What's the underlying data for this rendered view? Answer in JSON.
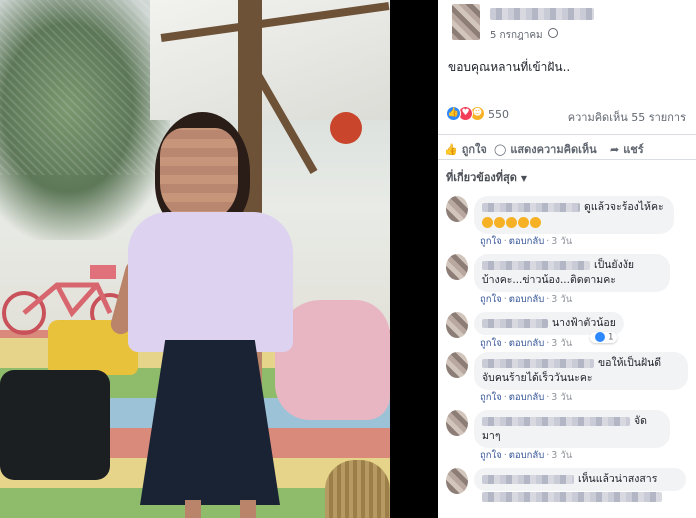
{
  "post": {
    "date": "5 กรกฎาคม",
    "text": "ขอบคุณหลานที่เข้าฝัน..",
    "reaction_count": "550",
    "comments_count": "ความคิดเห็น 55 รายการ",
    "actions": {
      "like": "ถูกใจ",
      "comment": "แสดงความคิดเห็น",
      "share": "แชร์"
    },
    "filter_label": "ที่เกี่ยวข้องที่สุด"
  },
  "comment_actions": {
    "like": "ถูกใจ",
    "reply": "ตอบกลับ",
    "sep": "·"
  },
  "comments": [
    {
      "text": "ดูแล้วจะร้องไห้คะ",
      "time": "3 วัน"
    },
    {
      "text_line1": "เป็นยังงัย",
      "text_line2": "บ้างคะ...ข่าวน้อง...ติดตามคะ",
      "time": "3 วัน"
    },
    {
      "text": "นางฟ้าตัวน้อย",
      "time": "3 วัน",
      "reaction_count": "1"
    },
    {
      "text_line1": "ขอให้เป็นฝันดี",
      "text_line2": "จับคนร้ายได้เร็ววันนะคะ",
      "time": "3 วัน"
    },
    {
      "text_line1": "จัด",
      "text_line2": "มาๆ",
      "time": "3 วัน"
    },
    {
      "text": "เห็นแล้วน่าสงสาร"
    }
  ],
  "icons": {
    "privacy": "globe-icon",
    "like_reaction": "like-reaction-icon",
    "love_reaction": "love-reaction-icon",
    "haha_reaction": "haha-reaction-icon",
    "like_action": "thumbs-up-icon",
    "comment_action": "comment-icon",
    "share_action": "share-arrow-icon",
    "filter_caret": "caret-down-icon"
  },
  "colors": {
    "link": "#385898",
    "like_blue": "#2d88ff",
    "love_red": "#f33e58",
    "haha_yellow": "#f7b125"
  }
}
